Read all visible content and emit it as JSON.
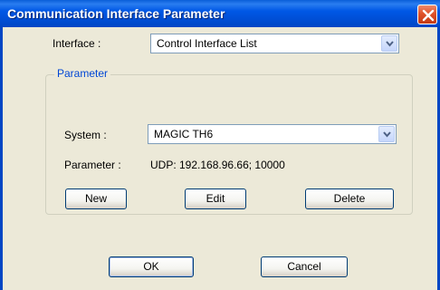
{
  "window": {
    "title": "Communication Interface Parameter"
  },
  "interface": {
    "label": "Interface :",
    "value": "Control Interface List"
  },
  "parameter_group": {
    "legend": "Parameter",
    "system_label": "System :",
    "system_value": "MAGIC TH6",
    "parameter_label": "Parameter :",
    "parameter_value": "UDP: 192.168.96.66; 10000",
    "new_label": "New",
    "edit_label": "Edit",
    "delete_label": "Delete"
  },
  "footer": {
    "ok_label": "OK",
    "cancel_label": "Cancel"
  },
  "colors": {
    "titlebar": "#0054e3",
    "legend_text": "#0046d5",
    "close_button": "#e0522a",
    "dialog_bg": "#ece9d8"
  },
  "icons": {
    "close": "close-icon",
    "dropdown": "chevron-down-icon"
  }
}
